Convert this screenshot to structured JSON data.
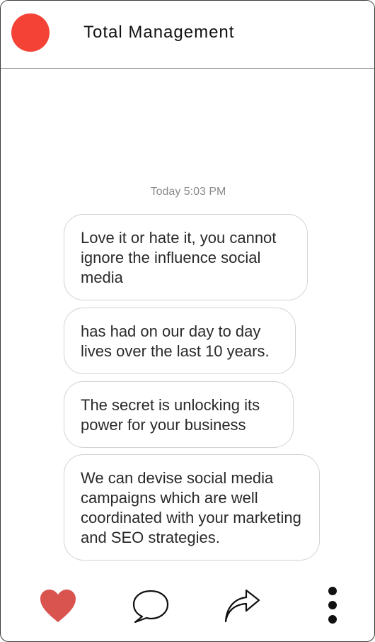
{
  "header": {
    "title": "Total Management",
    "avatar_color": "#f44336"
  },
  "chat": {
    "timestamp": "Today 5:03 PM",
    "messages": [
      {
        "text": "Love it or hate it, you cannot ignore the influence social media"
      },
      {
        "text": "has had on our day to day lives over the last 10 years."
      },
      {
        "text": "The secret is unlocking its power for your business"
      },
      {
        "text": "We can devise social media campaigns which are well coordinated with your marketing and SEO strategies."
      }
    ]
  },
  "actions": [
    {
      "icon": "heart-icon",
      "color": "#d9534f"
    },
    {
      "icon": "comment-icon"
    },
    {
      "icon": "share-icon"
    },
    {
      "icon": "more-icon"
    }
  ]
}
